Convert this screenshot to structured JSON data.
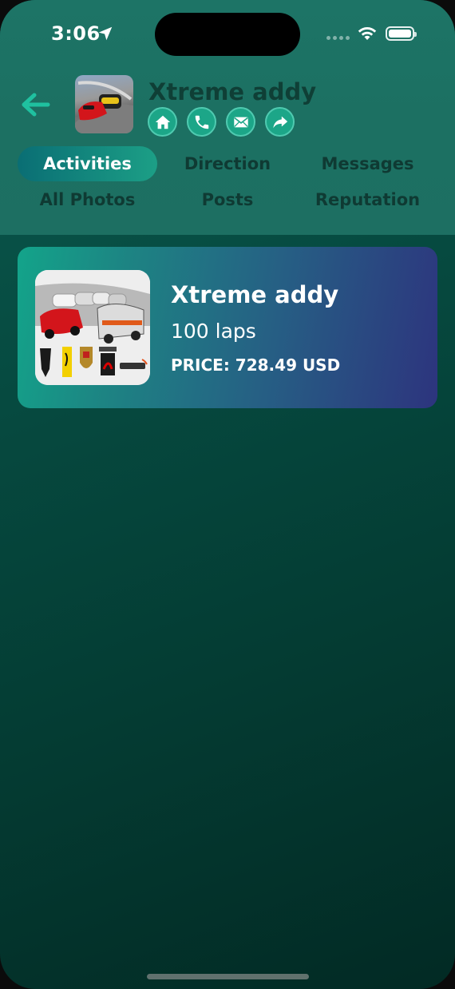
{
  "status_bar": {
    "time": "3:06"
  },
  "header": {
    "business_name": "Xtreme addy",
    "actions": [
      {
        "name": "home",
        "icon": "home-icon"
      },
      {
        "name": "call",
        "icon": "phone-icon"
      },
      {
        "name": "email",
        "icon": "mail-icon"
      },
      {
        "name": "share",
        "icon": "share-arrow-icon"
      }
    ]
  },
  "tabs": [
    {
      "label": "Activities",
      "active": true
    },
    {
      "label": "Direction",
      "active": false
    },
    {
      "label": "Messages",
      "active": false
    },
    {
      "label": "All Photos",
      "active": false
    },
    {
      "label": "Posts",
      "active": false
    },
    {
      "label": "Reputation",
      "active": false
    }
  ],
  "activities": [
    {
      "title": "Xtreme addy",
      "subtitle": "100 laps",
      "price": "PRICE: 728.49 USD"
    }
  ],
  "colors": {
    "accent": "#1ca688",
    "header_bg": "#1d7466",
    "background": "#043c33"
  }
}
